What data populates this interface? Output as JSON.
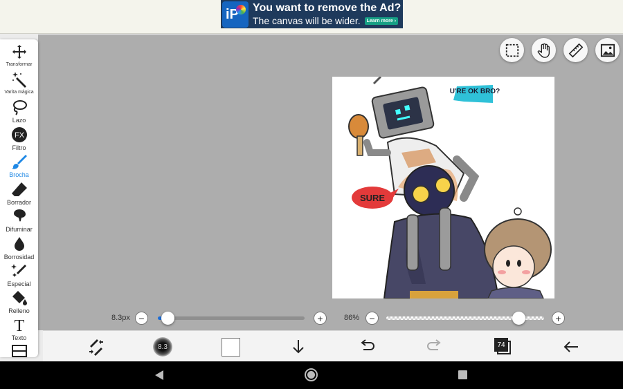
{
  "ad": {
    "logo": "iP",
    "headline": "You want to remove the Ad?",
    "subline": "The canvas will be wider.",
    "button": "Learn more ›"
  },
  "toolbar": {
    "items": [
      {
        "label": "Transformar",
        "icon": "move-arrows-icon"
      },
      {
        "label": "Varita mágica",
        "icon": "magic-wand-icon"
      },
      {
        "label": "Lazo",
        "icon": "lasso-icon"
      },
      {
        "label": "Filtro",
        "icon": "fx-icon",
        "glyph": "FX"
      },
      {
        "label": "Brocha",
        "icon": "brush-icon",
        "active": true
      },
      {
        "label": "Borrador",
        "icon": "eraser-icon"
      },
      {
        "label": "Difuminar",
        "icon": "smudge-icon"
      },
      {
        "label": "Borrosidad",
        "icon": "blur-drop-icon"
      },
      {
        "label": "Especial",
        "icon": "sparkle-pen-icon"
      },
      {
        "label": "Relleno",
        "icon": "bucket-icon"
      },
      {
        "label": "Texto",
        "icon": "text-icon",
        "glyph": "T"
      },
      {
        "label": "",
        "icon": "frame-icon"
      }
    ]
  },
  "top_buttons": [
    "selection-icon",
    "hand-icon",
    "ruler-icon",
    "image-icon"
  ],
  "size_slider": {
    "label": "8.3px",
    "minus": "−",
    "plus": "+",
    "value": 0.04
  },
  "opacity_slider": {
    "label": "86%",
    "minus": "−",
    "plus": "+",
    "value": 0.86
  },
  "bottom_bar": {
    "brush_size": "8.3",
    "color": "#ffffff",
    "layer_count": "74"
  },
  "artwork": {
    "bubble_top": "U'RE OK BRO?",
    "bubble_left": "SURE"
  }
}
